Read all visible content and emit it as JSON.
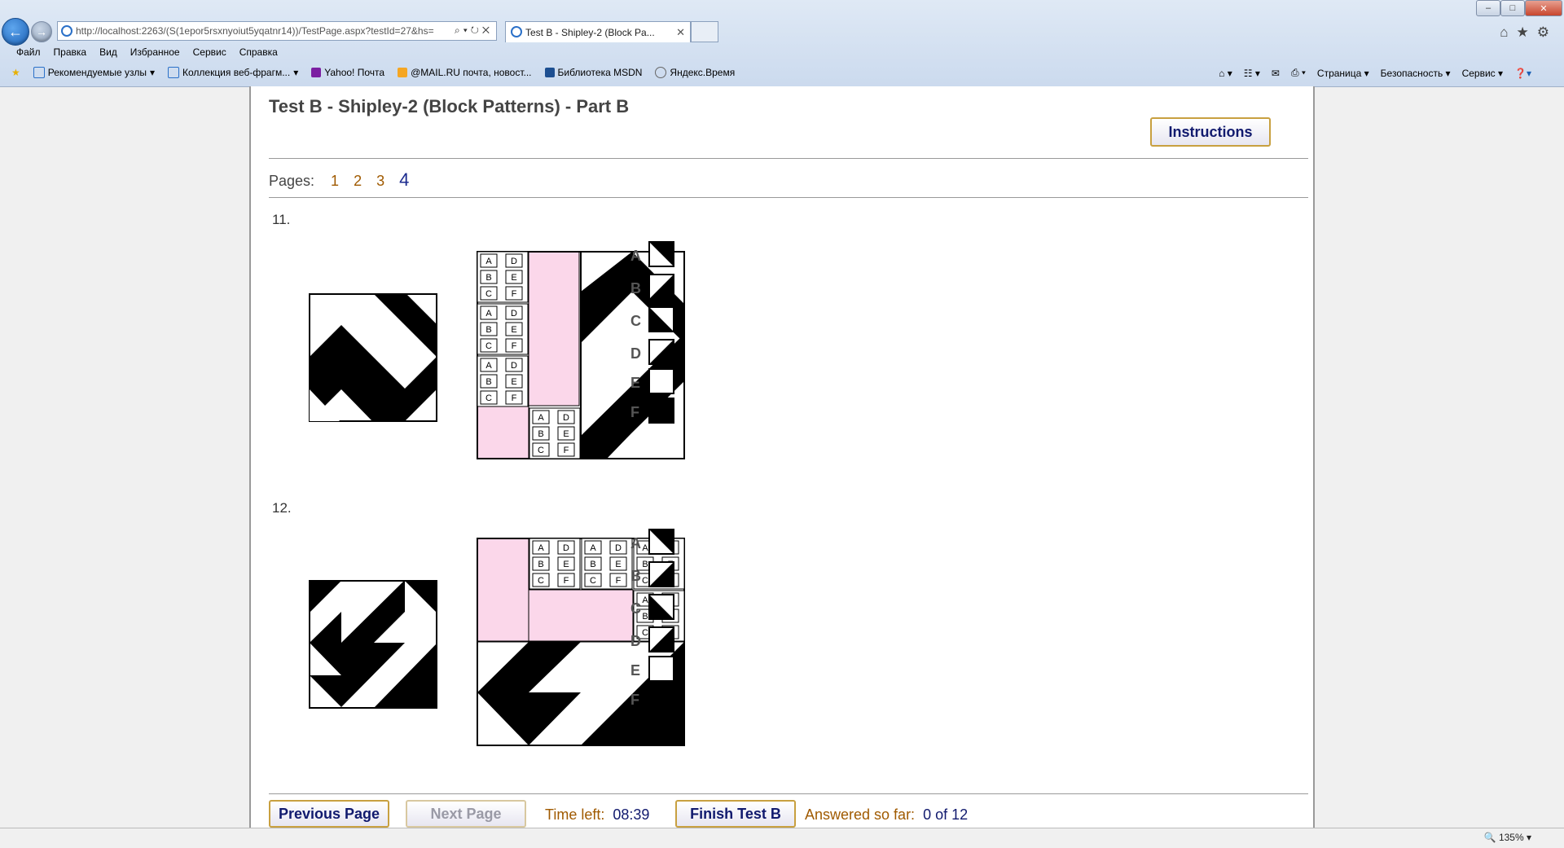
{
  "browser": {
    "url": "http://localhost:2263/(S(1epor5rsxnyoiut5yqatnr14))/TestPage.aspx?testId=27&hs=",
    "tab_title": "Test B - Shipley-2 (Block Pa...",
    "menu": [
      "Файл",
      "Правка",
      "Вид",
      "Избранное",
      "Сервис",
      "Справка"
    ],
    "favorites": [
      "Рекомендуемые узлы",
      "Коллекция веб-фрагм...",
      "Yahoo! Почта",
      "@MAIL.RU почта, новост...",
      "Библиотека MSDN",
      "Яндекс.Время"
    ],
    "commands": [
      "Страница",
      "Безопасность",
      "Сервис"
    ],
    "zoom": "135%"
  },
  "page": {
    "title": "Test B - Shipley-2 (Block Patterns) - Part B",
    "instructions_label": "Instructions",
    "pages_label": "Pages:",
    "pages": [
      "1",
      "2",
      "3",
      "4"
    ],
    "current_page": "4"
  },
  "questions": [
    {
      "number": "11.",
      "options": [
        "A",
        "B",
        "C",
        "D",
        "E",
        "F"
      ],
      "grid_letters": [
        "A",
        "D",
        "B",
        "E",
        "C",
        "F"
      ]
    },
    {
      "number": "12.",
      "options": [
        "A",
        "B",
        "C",
        "D",
        "E",
        "F"
      ],
      "grid_letters": [
        "A",
        "D",
        "B",
        "E",
        "C",
        "F"
      ]
    }
  ],
  "footer": {
    "prev_label": "Previous Page",
    "next_label": "Next Page",
    "time_label": "Time left:",
    "time_value": "08:39",
    "finish_label": "Finish Test B",
    "answered_label": "Answered so far:",
    "answered_value": "0 of 12"
  },
  "colors": {
    "accent_border": "#c8a040",
    "button_text": "#111a6e",
    "link_orange": "#a05a00",
    "pink_cell": "#fbd7ea"
  }
}
